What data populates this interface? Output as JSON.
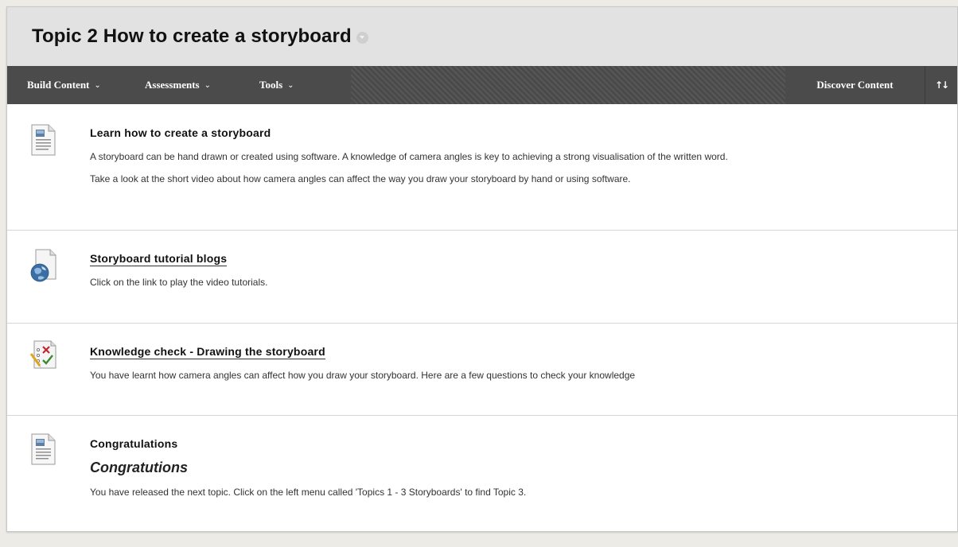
{
  "page": {
    "title": "Topic 2 How to create a storyboard"
  },
  "toolbar": {
    "build_content": "Build Content",
    "assessments": "Assessments",
    "tools": "Tools",
    "discover_content": "Discover Content",
    "chevron_glyph": "⌄",
    "sort_glyph": "↑↓"
  },
  "items": [
    {
      "icon": "document-icon",
      "title": "Learn how to create a storyboard",
      "paragraphs": [
        "A storyboard can be hand drawn or created using software.  A knowledge of camera angles is key to achieving a strong visualisation of the written word.",
        "Take a look at the short video about how camera angles can affect the way you draw your storyboard by hand or using software."
      ]
    },
    {
      "icon": "web-link-icon",
      "title": "Storyboard tutorial blogs",
      "paragraphs": [
        "Click on the link to play the video tutorials."
      ]
    },
    {
      "icon": "test-icon",
      "title": "Knowledge check - Drawing the storyboard",
      "paragraphs": [
        "You have learnt how camera angles can affect how you draw your storyboard.  Here are a few questions to check your knowledge"
      ]
    },
    {
      "icon": "document-icon",
      "title": "Congratulations",
      "heading": "Congratutions",
      "paragraphs": [
        "You have released the next topic.  Click on the left menu called 'Topics 1 - 3 Storyboards' to find Topic 3."
      ]
    }
  ]
}
